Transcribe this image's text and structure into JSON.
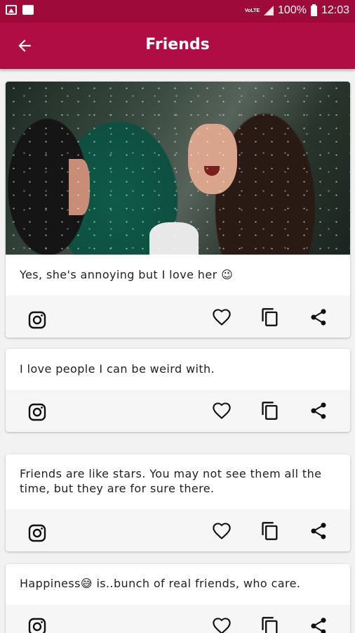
{
  "status_bar": {
    "network": "VoLTE",
    "battery": "100%",
    "time": "12:03"
  },
  "app_bar": {
    "title": "Friends"
  },
  "cards": [
    {
      "text": "Yes, she's annoying but I love her",
      "emoji": "😉",
      "has_image": true
    },
    {
      "text": "I love people I can be weird with."
    },
    {
      "text_line1": "Friends are like stars. You may not see them all the",
      "text_line2": "time, but they are for sure there."
    },
    {
      "text_before": "Happiness",
      "emoji": "😅",
      "text_after": " is..bunch of real friends, who care."
    }
  ],
  "icons": [
    "instagram-icon",
    "heart-icon",
    "copy-icon",
    "share-icon"
  ],
  "colors": {
    "status_bar": "#9e0a39",
    "app_bar": "#b00d45",
    "background": "#f2f2f2",
    "card": "#ffffff",
    "action_bar": "#f6f6f6"
  }
}
